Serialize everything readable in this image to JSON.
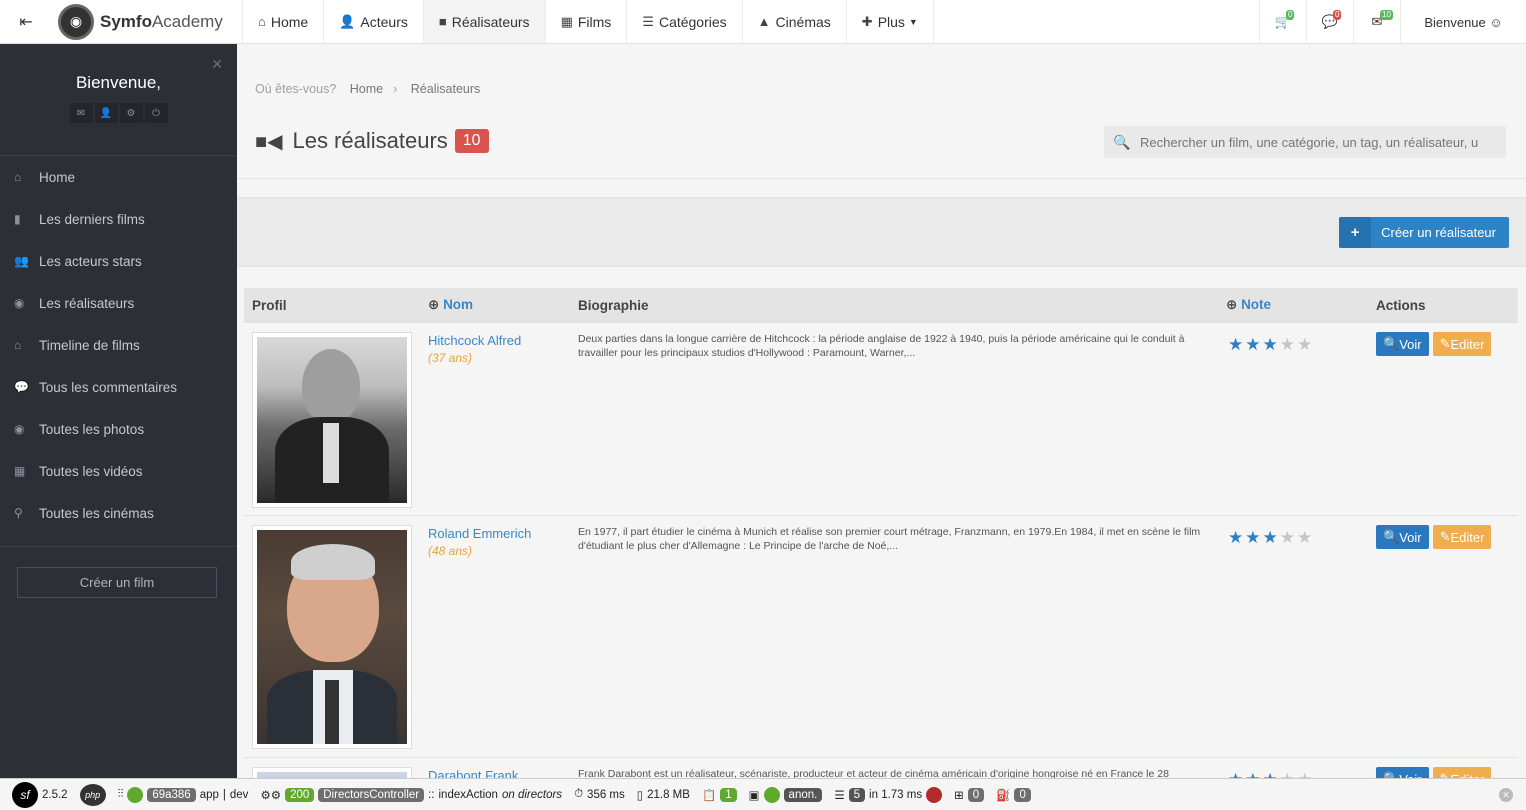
{
  "topbar": {
    "brand_bold": "Symfo",
    "brand_rest": "Academy",
    "nav": [
      {
        "label": "Home",
        "icon": "home-icon",
        "glyph": "⌂"
      },
      {
        "label": "Acteurs",
        "icon": "user-icon",
        "glyph": "👤"
      },
      {
        "label": "Réalisateurs",
        "icon": "video-camera-icon",
        "glyph": "■"
      },
      {
        "label": "Films",
        "icon": "film-icon",
        "glyph": "▦"
      },
      {
        "label": "Catégories",
        "icon": "list-icon",
        "glyph": "☰"
      },
      {
        "label": "Cinémas",
        "icon": "road-icon",
        "glyph": "▲"
      },
      {
        "label": "Plus",
        "icon": "plus-icon",
        "glyph": "✚"
      }
    ],
    "cart_badge": "0",
    "comments_badge": "0",
    "messages_badge": "10",
    "welcome": "Bienvenue ☺"
  },
  "sidebar": {
    "greeting": "Bienvenue,",
    "items": [
      {
        "label": "Home",
        "glyph": "⌂"
      },
      {
        "label": "Les derniers films",
        "glyph": "▮"
      },
      {
        "label": "Les acteurs stars",
        "glyph": "👥"
      },
      {
        "label": "Les réalisateurs",
        "glyph": "◉"
      },
      {
        "label": "Timeline de films",
        "glyph": "⌂"
      },
      {
        "label": "Tous les commentaires",
        "glyph": "💬"
      },
      {
        "label": "Toutes les photos",
        "glyph": "◉"
      },
      {
        "label": "Toutes les vidéos",
        "glyph": "▦"
      },
      {
        "label": "Toutes les cinémas",
        "glyph": "⚲"
      }
    ],
    "create_label": "Créer un film"
  },
  "breadcrumb": {
    "prefix": "Où êtes-vous?",
    "home": "Home",
    "current": "Réalisateurs"
  },
  "page": {
    "title": "Les réalisateurs",
    "count": "10"
  },
  "search": {
    "placeholder": "Rechercher un film, une catégorie, un tag, un réalisateur, u"
  },
  "create_button": "Créer un réalisateur",
  "table": {
    "headers": {
      "profil": "Profil",
      "nom": "Nom",
      "bio": "Biographie",
      "note": "Note",
      "actions": "Actions"
    },
    "view_label": "Voir",
    "edit_label": "Editer",
    "rows": [
      {
        "name": "Hitchcock Alfred",
        "age": "(37 ans)",
        "bio": "Deux parties dans la longue carrière de Hitchcock : la période anglaise de 1922 à 1940, puis la période américaine qui le conduit à travailler pour les principaux studios d'Hollywood : Paramount, Warner,...",
        "rating": 3
      },
      {
        "name": "Roland Emmerich",
        "age": "(48 ans)",
        "bio": "En 1977, il part étudier le cinéma à Munich et réalise son premier court métrage, Franzmann, en 1979.En 1984, il met en scène le film d'étudiant le plus cher d'Allemagne : Le Principe de l'arche de Noé,...",
        "rating": 3
      },
      {
        "name": "Darabont Frank",
        "age": "",
        "bio": "Frank Darabont est un réalisateur, scénariste, producteur et acteur de cinéma américain d'origine hongroise né en France le 28",
        "rating": 3
      }
    ]
  },
  "sfbar": {
    "version": "2.5.2",
    "php": "php",
    "token": "69a386",
    "app": "app",
    "env": "dev",
    "status": "200",
    "controller": "DirectorsController",
    "action": "indexAction",
    "route": "on directors",
    "time": "356 ms",
    "memory": "21.8 MB",
    "logs": "1",
    "user": "anon.",
    "queries": "5",
    "query_time": "in 1.73 ms",
    "forms": "0",
    "events": "0"
  },
  "colors": {
    "accent": "#2c84c7",
    "badge": "#d9534f",
    "edit": "#f0ad4e",
    "sidebar": "#2c3036"
  }
}
